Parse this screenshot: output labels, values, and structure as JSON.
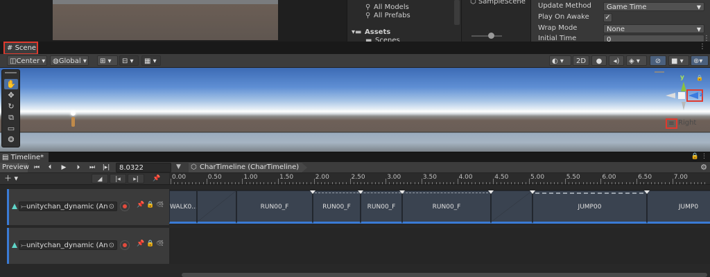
{
  "project": {
    "items": [
      {
        "label": "All Models",
        "icon": "search-icon"
      },
      {
        "label": "All Prefabs",
        "icon": "search-icon"
      },
      {
        "label": "Assets",
        "icon": "folder-icon"
      },
      {
        "label": "Scenes",
        "icon": "folder-icon"
      }
    ]
  },
  "hierarchy": {
    "scene_name": "SampleScene"
  },
  "inspector": {
    "update_method_label": "Update Method",
    "update_method_value": "Game Time",
    "play_on_awake_label": "Play On Awake",
    "play_on_awake_checked": "✓",
    "wrap_mode_label": "Wrap Mode",
    "wrap_mode_value": "None",
    "initial_time_label": "Initial Time",
    "initial_time_value": "0"
  },
  "scene": {
    "tab_label": "Scene",
    "tab_icon": "hash-icon",
    "toolbar": {
      "pivot_label": "Center",
      "space_label": "Global",
      "mode_2d_label": "2D"
    },
    "tools": [
      "hand-tool",
      "move-tool",
      "rotate-tool",
      "scale-tool",
      "rect-tool",
      "transform-tool"
    ],
    "gizmo": {
      "y_label": "y",
      "z_label": "z"
    },
    "perspective_label": "Right"
  },
  "timeline": {
    "tab_label": "Timeline*",
    "preview_label": "Preview",
    "current_time": "8.0322",
    "asset_label": "CharTimeline (CharTimeline)",
    "ruler": [
      "0.00",
      "0.50",
      "1.00",
      "1.50",
      "2.00",
      "2.50",
      "3.00",
      "3.50",
      "4.00",
      "4.50",
      "5.00",
      "5.50",
      "6.00",
      "6.50",
      "7.00"
    ],
    "tracks": [
      {
        "binding": "unitychan_dynamic (An",
        "clips": [
          "WALK0...",
          "RUN00_F",
          "RUN00_F",
          "RUN00_F",
          "RUN00_F",
          "JUMP00",
          "JUMP0"
        ]
      },
      {
        "binding": "unitychan_dynamic (An",
        "clips": []
      }
    ]
  },
  "colors": {
    "accent": "#3a7bd5",
    "highlight": "#e03a2e",
    "track_icon": "#5fd6c8",
    "record": "#e24b3d"
  }
}
